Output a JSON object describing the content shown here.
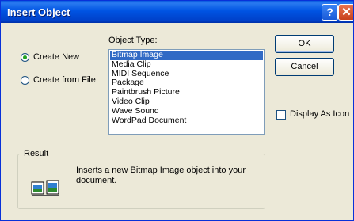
{
  "dialog": {
    "title": "Insert Object",
    "help_button": "?",
    "close_button": "✕"
  },
  "options": {
    "create_new_label": "Create New",
    "create_from_file_label": "Create from File",
    "selected": "create_new"
  },
  "object_type": {
    "label": "Object Type:",
    "items": [
      "Bitmap Image",
      "Media Clip",
      "MIDI Sequence",
      "Package",
      "Paintbrush Picture",
      "Video Clip",
      "Wave Sound",
      "WordPad Document"
    ],
    "selected_index": 0
  },
  "buttons": {
    "ok": "OK",
    "cancel": "Cancel"
  },
  "display_as_icon": {
    "label": "Display As Icon",
    "checked": false
  },
  "result": {
    "legend": "Result",
    "line1": "Inserts a new Bitmap Image object into your",
    "line2": "document.",
    "icon": "bitmap-object-icon"
  },
  "colors": {
    "titlebar": "#0054e3",
    "selection": "#316ac5",
    "dialog_bg": "#ece9d8"
  }
}
